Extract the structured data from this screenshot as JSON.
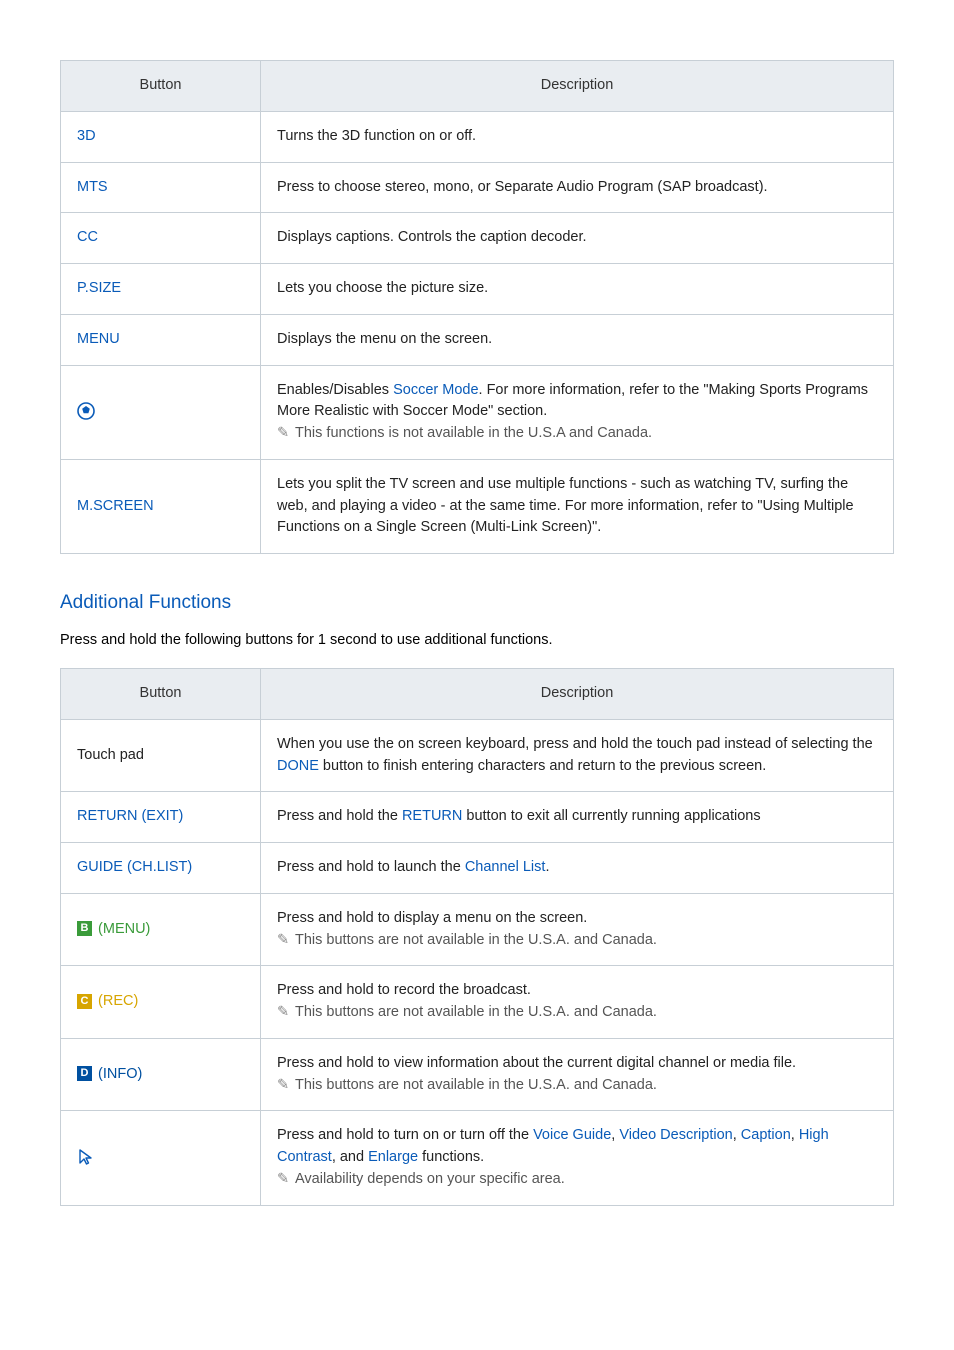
{
  "table1": {
    "headers": [
      "Button",
      "Description"
    ],
    "rows": [
      {
        "btn": "3D",
        "desc": "Turns the 3D function on or off."
      },
      {
        "btn": "MTS",
        "desc": "Press to choose stereo, mono, or Separate Audio Program (SAP broadcast)."
      },
      {
        "btn": "CC",
        "desc": "Displays captions. Controls the caption decoder."
      },
      {
        "btn": "P.SIZE",
        "desc": "Lets you choose the picture size."
      },
      {
        "btn": "MENU",
        "desc": "Displays the menu on the screen."
      },
      {
        "btn_icon": "soccer-icon",
        "desc_pre": "Enables/Disables ",
        "desc_link": "Soccer Mode",
        "desc_post": ". For more information, refer to the \"Making Sports Programs More Realistic with Soccer Mode\" section.",
        "note": "This functions is not available in the U.S.A and Canada."
      },
      {
        "btn": "M.SCREEN",
        "desc": "Lets you split the TV screen and use multiple functions - such as watching TV, surfing the web, and playing a video - at the same time. For more information, refer to \"Using Multiple Functions on a Single Screen (Multi-Link Screen)\"."
      }
    ]
  },
  "section_title": "Additional Functions",
  "section_lead": "Press and hold the following buttons for 1 second to use additional functions.",
  "table2": {
    "headers": [
      "Button",
      "Description"
    ],
    "rows": {
      "touchpad": {
        "btn": "Touch pad",
        "pre": "When you use the on screen keyboard, press and hold the touch pad instead of selecting the ",
        "link": "DONE",
        "post": " button to finish entering characters and return to the previous screen."
      },
      "return": {
        "btn": "RETURN (EXIT)",
        "pre": "Press and hold the ",
        "link": "RETURN",
        "post": " button to exit all currently running applications"
      },
      "guide": {
        "btn": "GUIDE (CH.LIST)",
        "pre": "Press and hold to launch the ",
        "link": "Channel List",
        "post": "."
      },
      "bmenu": {
        "tag": "B",
        "label": "(MENU)",
        "desc": "Press and hold to display a menu on the screen.",
        "note": "This buttons are not available in the U.S.A. and Canada."
      },
      "crec": {
        "tag": "C",
        "label": "(REC)",
        "desc": "Press and hold to record the broadcast.",
        "note": "This buttons are not available in the U.S.A. and Canada."
      },
      "dinfo": {
        "tag": "D",
        "label": "(INFO)",
        "desc": "Press and hold to view information about the current digital channel or media file.",
        "note": "This buttons are not available in the U.S.A. and Canada."
      },
      "accessibility": {
        "pre": "Press and hold to turn on or turn off the ",
        "l1": "Voice Guide",
        "s1": ", ",
        "l2": "Video Description",
        "s2": ", ",
        "l3": "Caption",
        "s3": ", ",
        "l4": "High Contrast",
        "s4": ", and ",
        "l5": "Enlarge",
        "post": " functions.",
        "note": "Availability depends on your specific area."
      }
    }
  }
}
